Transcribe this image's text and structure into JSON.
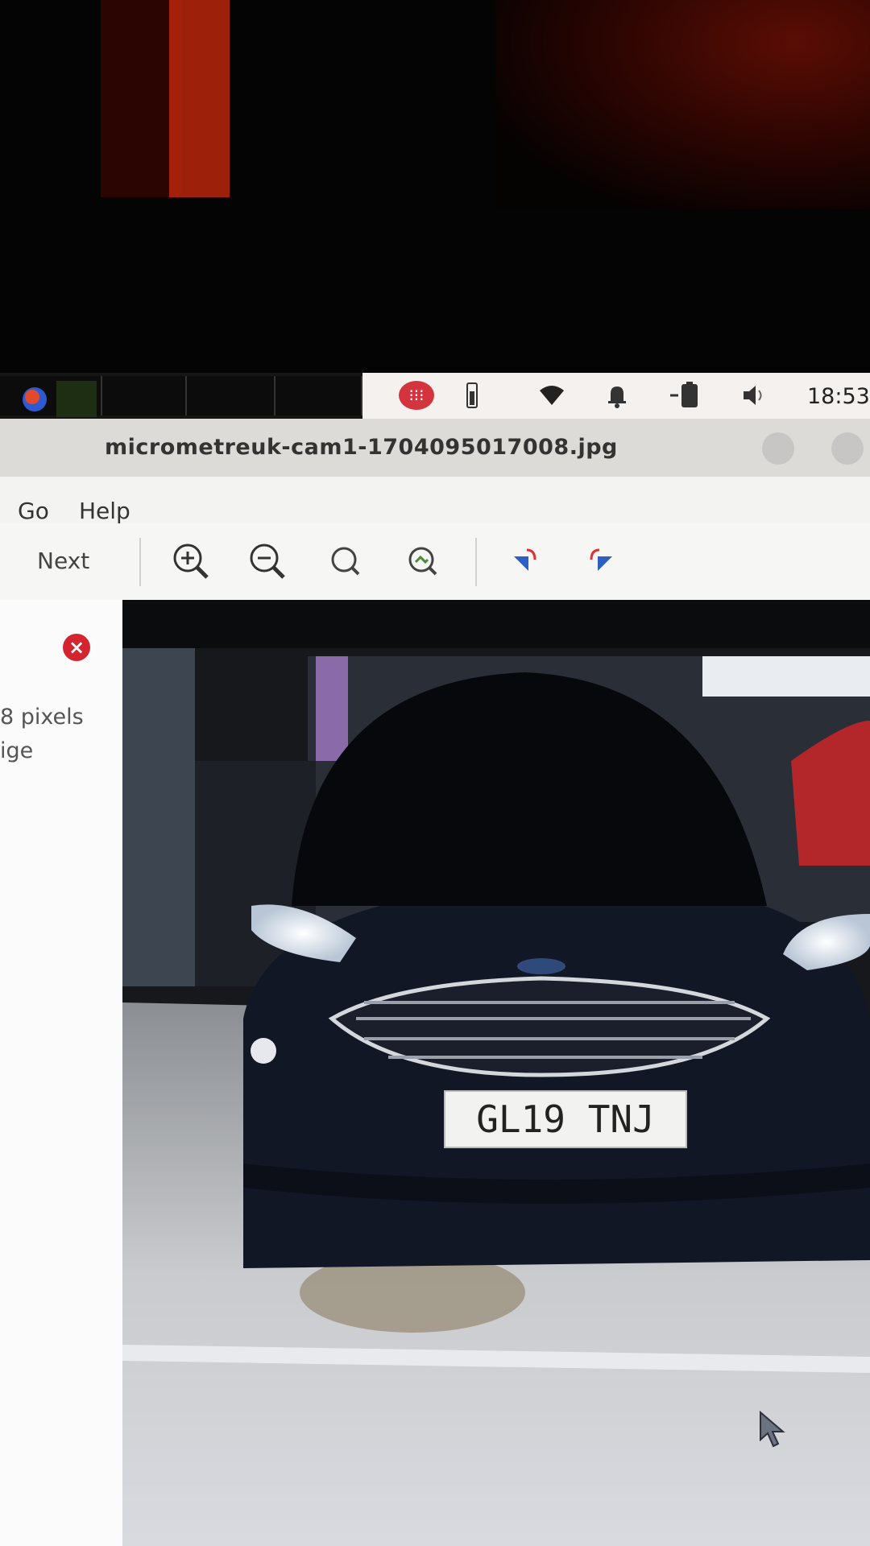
{
  "window": {
    "title": "micrometreuk-cam1-1704095017008.jpg"
  },
  "topbar": {
    "clock": "18:53",
    "tray_icons": [
      "app-indicator-icon",
      "battery-meter-icon",
      "wifi-icon",
      "bell-icon",
      "battery-icon",
      "volume-icon"
    ]
  },
  "menu": {
    "items": [
      "Go",
      "Help"
    ]
  },
  "toolbar": {
    "next_label": "Next",
    "buttons": [
      "zoom-in-icon",
      "zoom-out-icon",
      "zoom-normal-icon",
      "best-fit-icon",
      "rotate-left-icon",
      "rotate-right-icon"
    ]
  },
  "sidebar": {
    "close_glyph": "×",
    "line1": "8 pixels",
    "line2": "ige"
  },
  "image": {
    "plate": "GL19 TNJ"
  }
}
